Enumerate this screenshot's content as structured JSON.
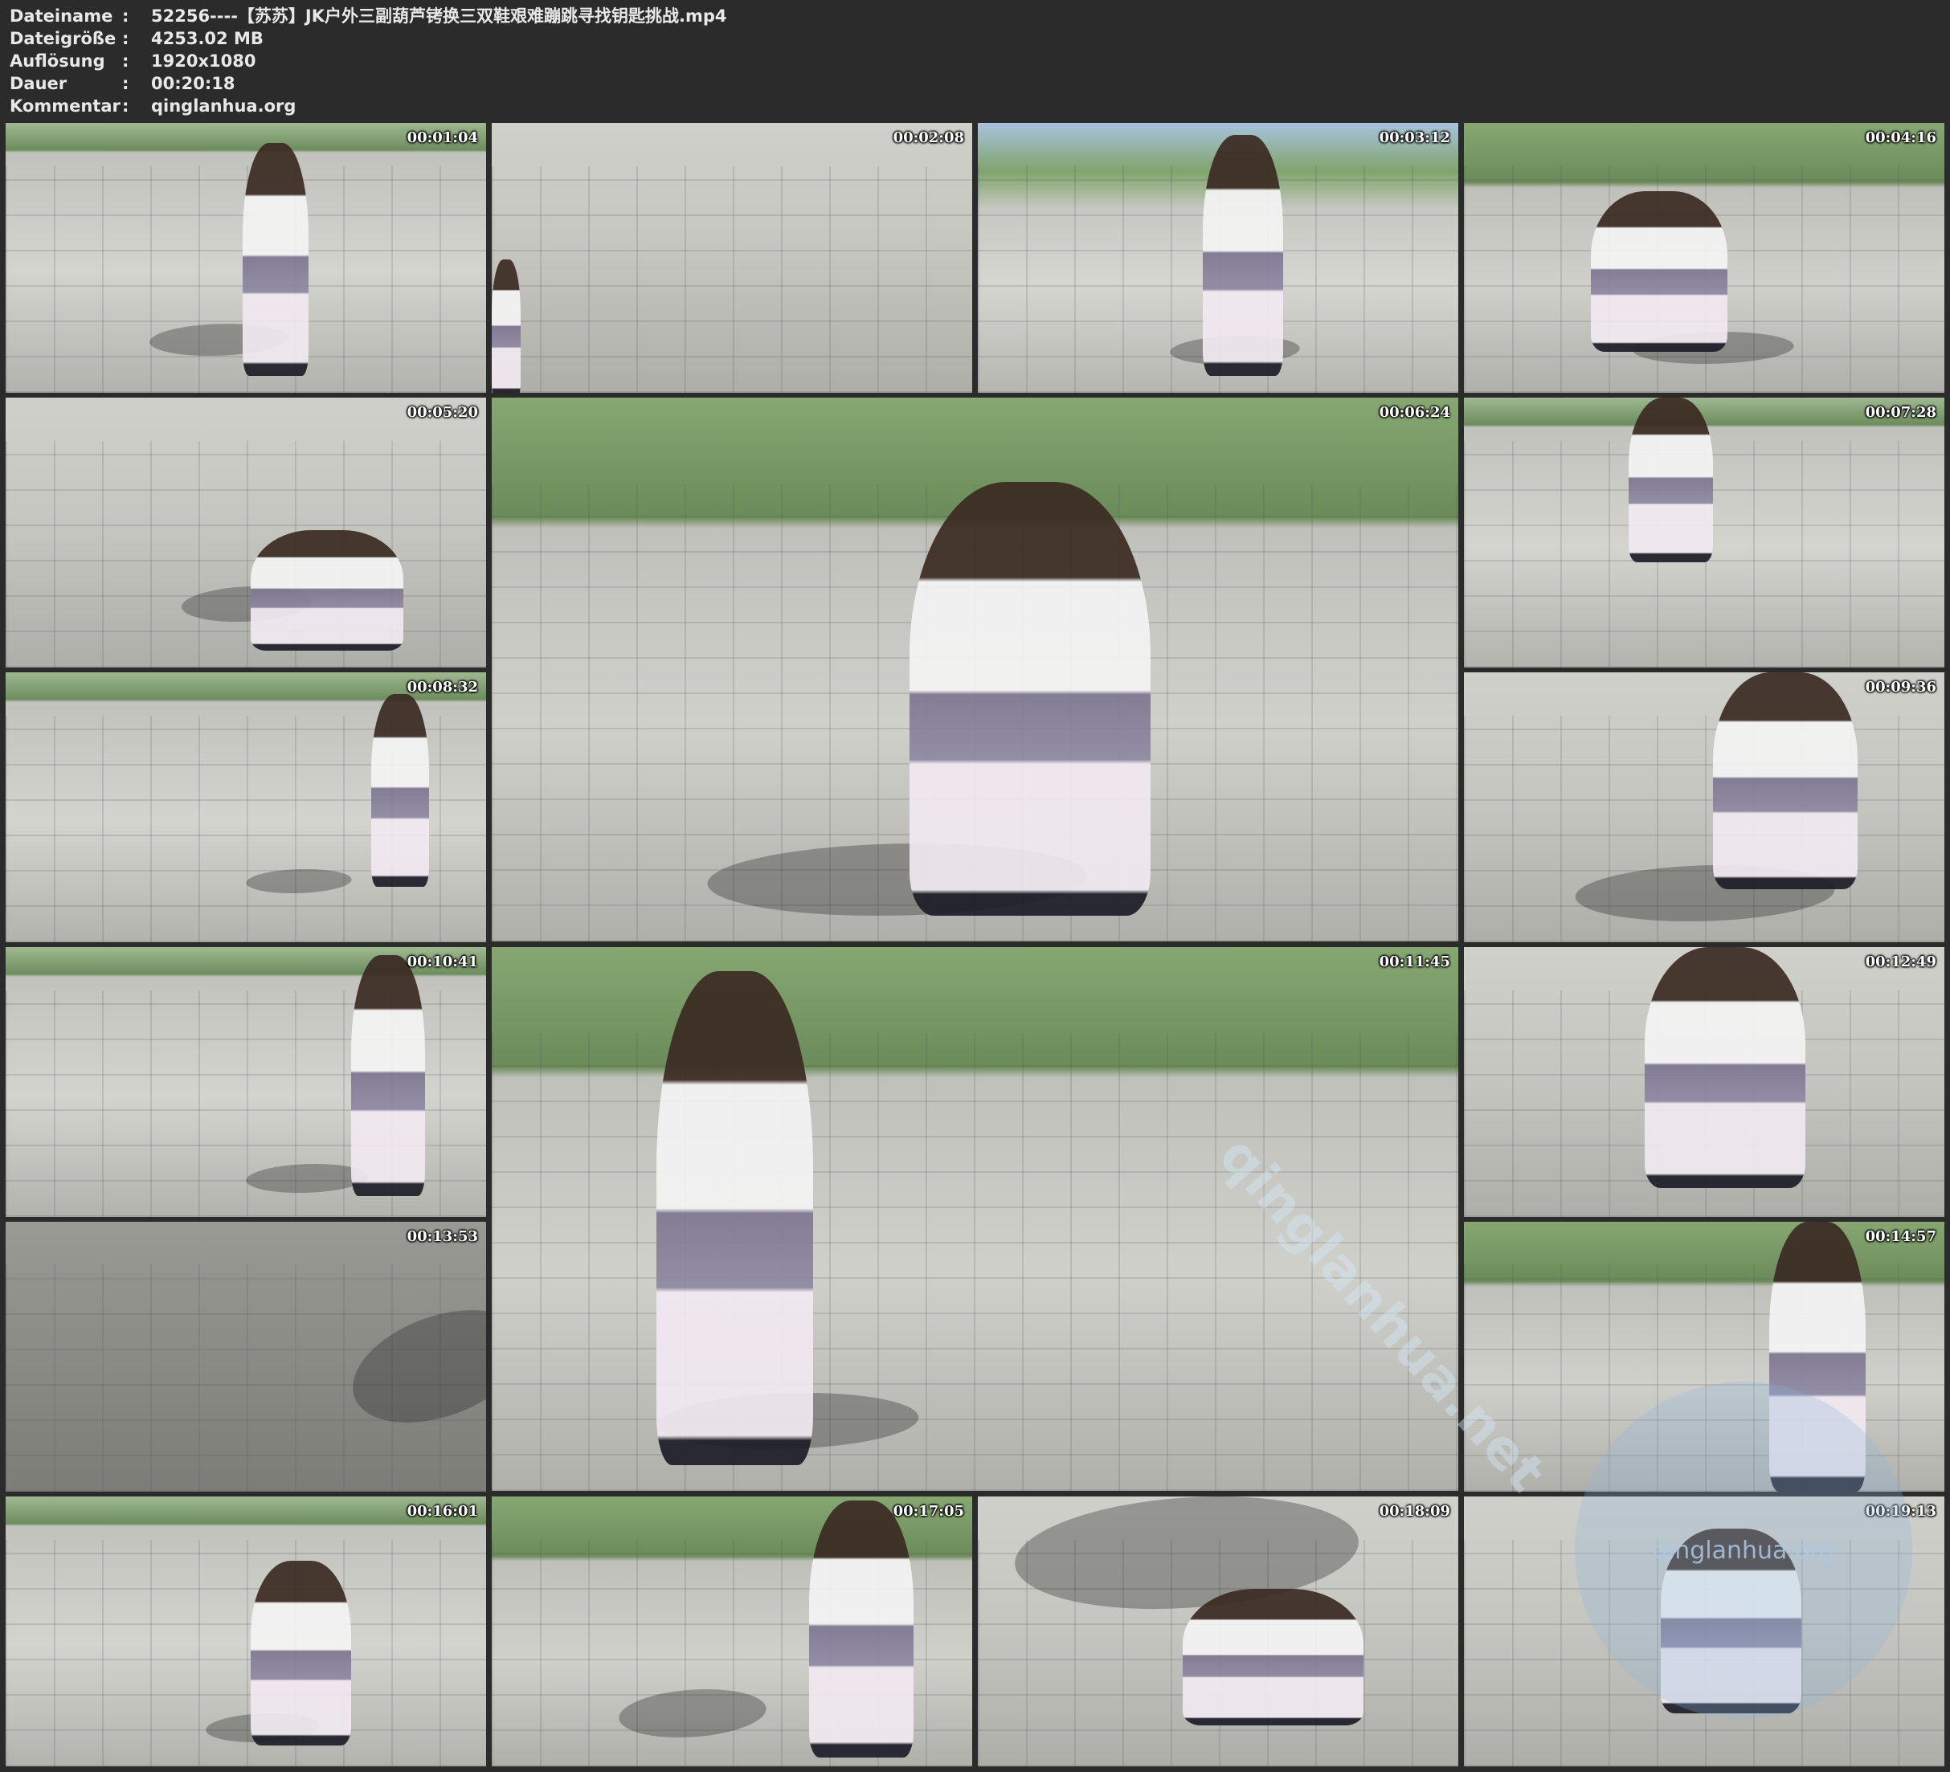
{
  "info": {
    "rows": [
      {
        "label": "Dateiname",
        "sep": ":",
        "value": "52256----【苏苏】JK户外三副葫芦铐换三双鞋艰难蹦跳寻找钥匙挑战.mp4"
      },
      {
        "label": "Dateigröße",
        "sep": ":",
        "value": "4253.02 MB"
      },
      {
        "label": "Auflösung",
        "sep": ":",
        "value": "1920x1080"
      },
      {
        "label": "Dauer",
        "sep": ":",
        "value": "00:20:18"
      },
      {
        "label": "Kommentar",
        "sep": ":",
        "value": "qinglanhua.org"
      }
    ]
  },
  "thumbnails": [
    {
      "time": "00:01:04"
    },
    {
      "time": "00:02:08"
    },
    {
      "time": "00:03:12"
    },
    {
      "time": "00:04:16"
    },
    {
      "time": "00:05:20"
    },
    {
      "time": "00:06:24"
    },
    {
      "time": "00:07:28"
    },
    {
      "time": "00:08:32"
    },
    {
      "time": "00:09:36"
    },
    {
      "time": "00:10:41"
    },
    {
      "time": "00:11:45"
    },
    {
      "time": "00:12:49"
    },
    {
      "time": "00:13:53"
    },
    {
      "time": "00:14:57"
    },
    {
      "time": "00:16:01"
    },
    {
      "time": "00:17:05"
    },
    {
      "time": "00:18:09"
    },
    {
      "time": "00:19:13"
    }
  ],
  "watermarks": {
    "circle_text": "qinglanhua.org",
    "diagonal_text": "qinglanhua.net"
  }
}
